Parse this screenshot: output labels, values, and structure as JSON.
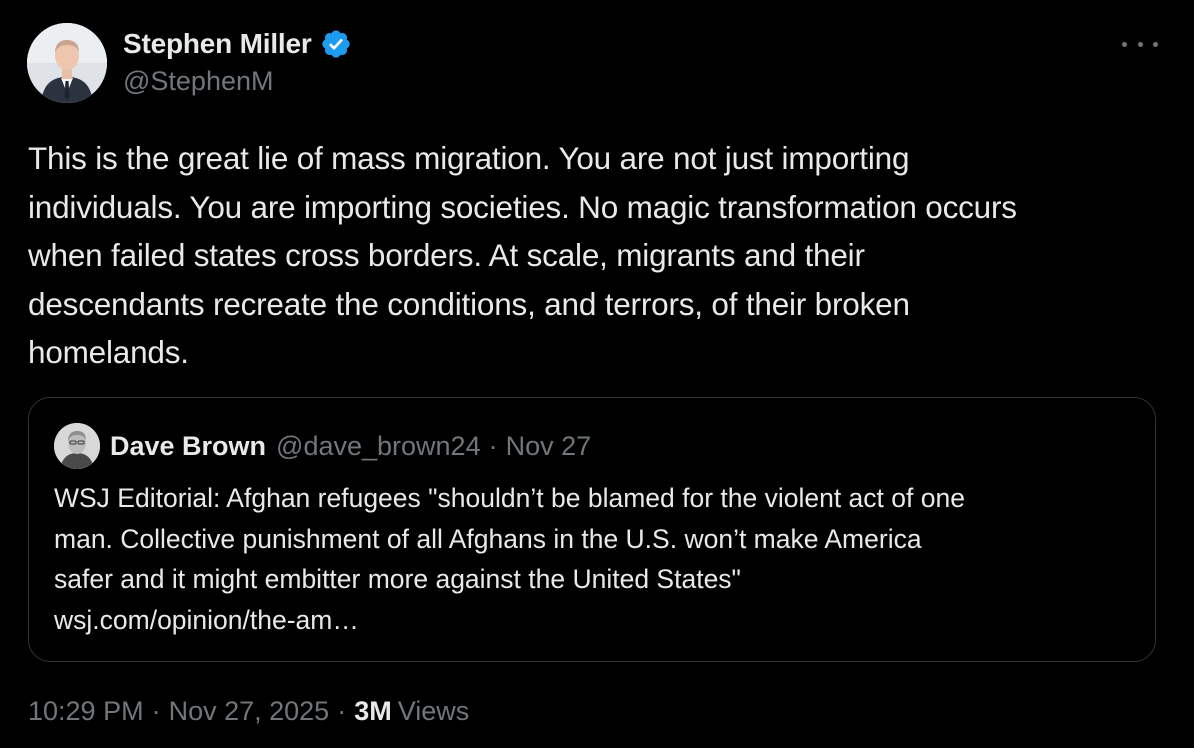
{
  "author": {
    "display_name": "Stephen Miller",
    "handle": "@StephenM",
    "verified": true
  },
  "tweet": {
    "text": "This is the great lie of mass migration. You are not just importing\nindividuals. You are importing societies. No magic transformation occurs\nwhen failed states cross borders. At scale, migrants and their\ndescendants recreate the conditions, and terrors, of their broken\nhomelands."
  },
  "quote": {
    "display_name": "Dave Brown",
    "handle": "@dave_brown24",
    "separator": "·",
    "date": "Nov 27",
    "text": "WSJ Editorial: Afghan refugees \"shouldn’t be blamed for the violent act of one\nman. Collective punishment of all Afghans in the U.S. won’t make America\nsafer and it might embitter more against the United States\"\nwsj.com/opinion/the-am…"
  },
  "meta": {
    "time": "10:29 PM",
    "separator": "·",
    "date": "Nov 27, 2025",
    "views_count": "3M",
    "views_label": "Views"
  },
  "icons": {
    "verified": "verified-badge-icon",
    "more": "more-options-icon"
  },
  "colors": {
    "background": "#000000",
    "primary_text": "#e7e9ea",
    "secondary_text": "#71767b",
    "verified_blue": "#1d9bf0",
    "border": "#2f3336"
  }
}
